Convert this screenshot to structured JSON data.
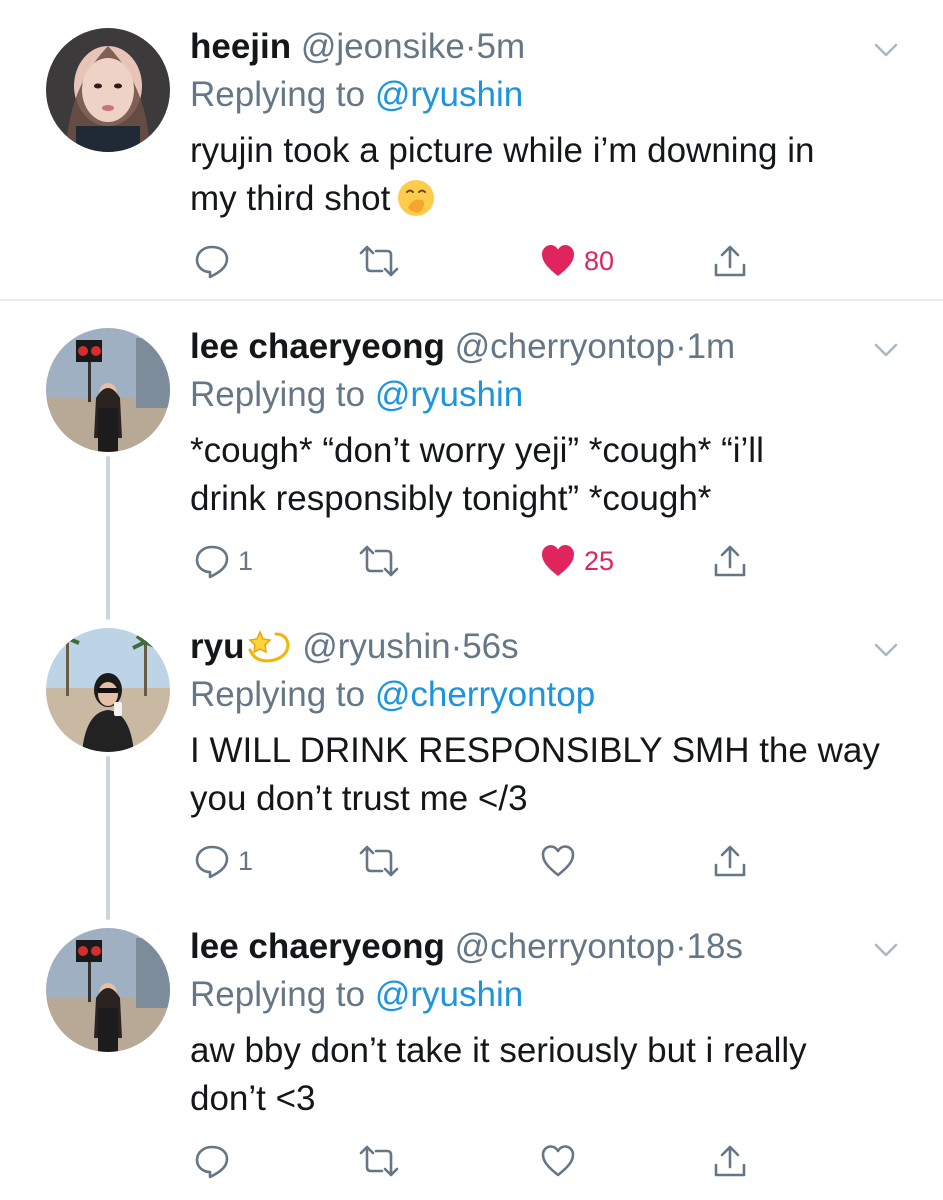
{
  "tweets": [
    {
      "name": "heejin",
      "handle": "@jeonsike",
      "dot": "·",
      "time": "5m",
      "replying_prefix": "Replying to ",
      "replying_to": "@ryushin",
      "text_lines": [
        "ryujin took a picture while i’m downing in",
        "my third shot"
      ],
      "emoji": "hand-over-mouth-emoji",
      "reply_count": "",
      "like_count": "80",
      "liked": true
    },
    {
      "name": "lee chaeryeong",
      "handle": "@cherryontop",
      "dot": "·",
      "time": "1m",
      "replying_prefix": "Replying to ",
      "replying_to": "@ryushin",
      "text_lines": [
        "*cough* “don’t worry yeji” *cough* “i’ll",
        "drink responsibly tonight” *cough*"
      ],
      "reply_count": "1",
      "like_count": "25",
      "liked": true
    },
    {
      "name": "ryu",
      "name_emoji": "dizzy-emoji",
      "handle": "@ryushin",
      "dot": "·",
      "time": "56s",
      "replying_prefix": "Replying to ",
      "replying_to": "@cherryontop",
      "text_lines": [
        "I WILL DRINK RESPONSIBLY SMH the way",
        "you don’t trust me </3"
      ],
      "reply_count": "1",
      "like_count": "",
      "liked": false
    },
    {
      "name": "lee chaeryeong",
      "handle": "@cherryontop",
      "dot": "·",
      "time": "18s",
      "replying_prefix": "Replying to ",
      "replying_to": "@ryushin",
      "text_lines": [
        "aw bby don’t take it seriously but i really",
        "don’t <3"
      ],
      "reply_count": "",
      "like_count": "",
      "liked": false
    }
  ],
  "colors": {
    "text": "#14171a",
    "secondary": "#657786",
    "link": "#1b95e0",
    "like": "#e0245e",
    "divider": "#e6ecf0",
    "thread_line": "#ccd6dd"
  }
}
